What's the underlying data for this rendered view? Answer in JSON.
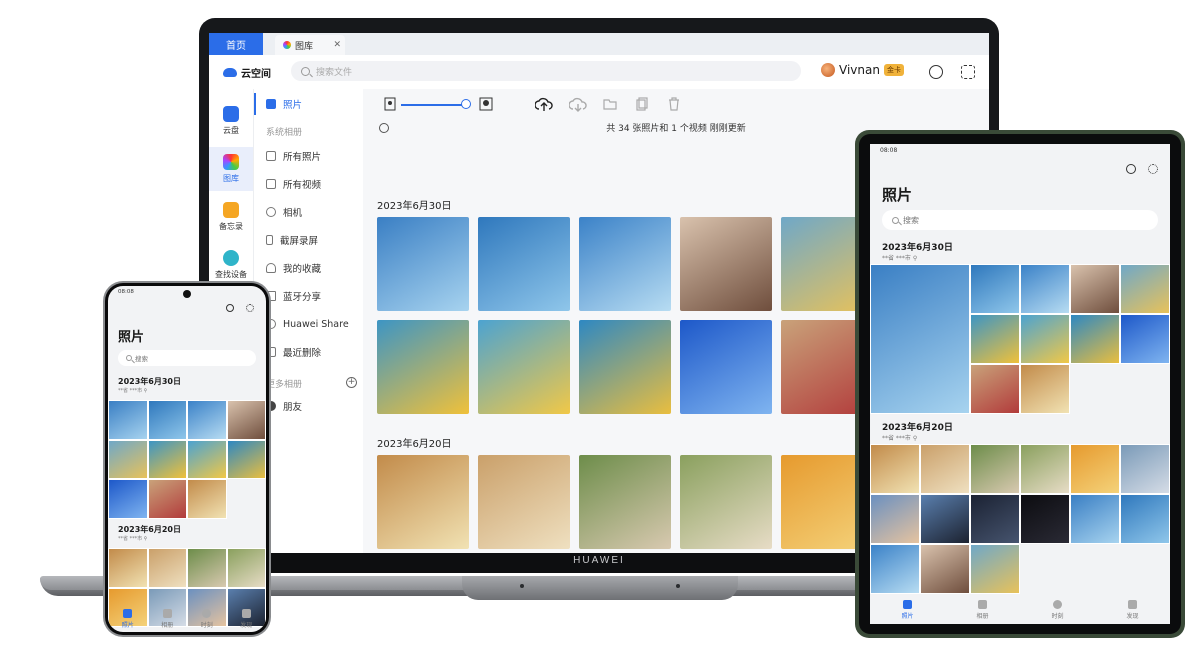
{
  "laptop": {
    "brand": "HUAWEI",
    "tabs": {
      "home": "首页",
      "gallery": "图库",
      "close": "✕"
    },
    "header": {
      "app_name": "云空间",
      "search_placeholder": "搜索文件",
      "username": "Vivnan",
      "badge": "金卡"
    },
    "rail": [
      {
        "label": "云盘",
        "color": "#2b6de8"
      },
      {
        "label": "图库",
        "color": "#f5a623"
      },
      {
        "label": "备忘录",
        "color": "#f5a623"
      },
      {
        "label": "查找设备",
        "color": "#2fb4c9"
      }
    ],
    "sidebar": {
      "photos": "照片",
      "system_albums": "系统相册",
      "items": [
        "所有照片",
        "所有视频",
        "相机",
        "截屏录屏",
        "我的收藏",
        "蓝牙分享",
        "Huawei Share",
        "最近删除"
      ],
      "more_albums": "更多相册",
      "friends": "朋友"
    },
    "toolbar": {
      "zoom_level": 0.95
    },
    "status": "共 34 张照片和 1 个视频   刚刚更新",
    "sections": [
      {
        "date": "2023年6月30日"
      },
      {
        "date": "2023年6月20日"
      }
    ],
    "icons": [
      "user-small-icon",
      "user-large-icon",
      "cloud-upload-icon",
      "cloud-download-icon",
      "folder-move-icon",
      "copy-icon",
      "trash-icon",
      "clock-icon",
      "gear-icon",
      "info-icon"
    ]
  },
  "tablet": {
    "time": "08:08",
    "title": "照片",
    "search_placeholder": "搜索",
    "sections": [
      {
        "date": "2023年6月30日",
        "location": "**省 ***市 ⚲"
      },
      {
        "date": "2023年6月20日",
        "location": "**省 ***市 ⚲"
      }
    ],
    "nav": [
      "照片",
      "相册",
      "时刻",
      "发现"
    ]
  },
  "phone": {
    "time": "08:08",
    "title": "照片",
    "search_placeholder": "搜索",
    "sections": [
      {
        "date": "2023年6月30日",
        "location": "**省 ***市 ⚲"
      },
      {
        "date": "2023年6月20日",
        "location": "**省 ***市 ⚲"
      }
    ],
    "nav": [
      "照片",
      "相册",
      "时刻",
      "发现"
    ]
  },
  "colors": {
    "accent": "#2b6de8",
    "laptop_frame": "#16181b",
    "tablet_frame": "#3a4a38"
  }
}
